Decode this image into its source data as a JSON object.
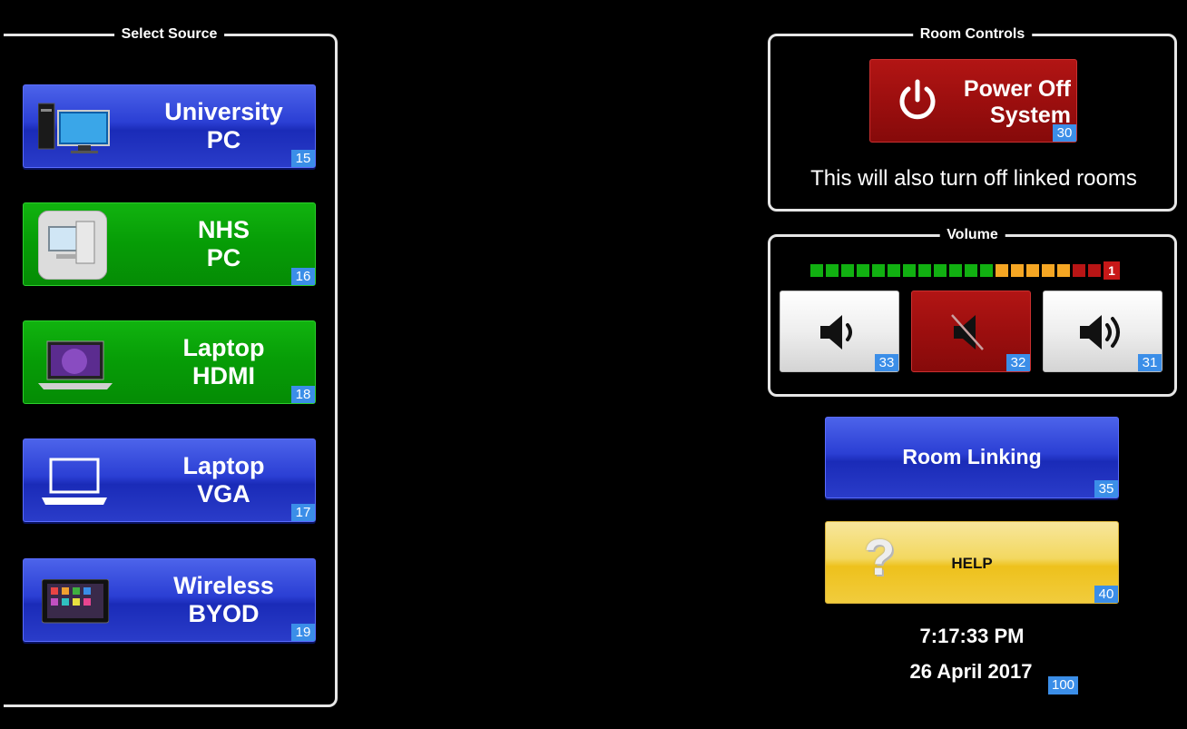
{
  "source_panel": {
    "title": "Select Source",
    "items": [
      {
        "line1": "University",
        "line2": "PC",
        "number": "15",
        "icon": "desktop-computer-icon"
      },
      {
        "line1": "NHS",
        "line2": "PC",
        "number": "16",
        "icon": "workstation-icon"
      },
      {
        "line1": "Laptop",
        "line2": "HDMI",
        "number": "18",
        "icon": "laptop-icon"
      },
      {
        "line1": "Laptop",
        "line2": "VGA",
        "number": "17",
        "icon": "laptop-outline-icon"
      },
      {
        "line1": "Wireless",
        "line2": "BYOD",
        "number": "19",
        "icon": "tablet-icon"
      }
    ]
  },
  "room_controls": {
    "title": "Room Controls",
    "power_button": {
      "line1": "Power Off",
      "line2": "System",
      "number": "30",
      "icon": "power-icon"
    },
    "note": "This will also turn off linked rooms"
  },
  "volume": {
    "title": "Volume",
    "level": "1",
    "segment_colors": {
      "green": "#11b011",
      "orange": "#f5a623",
      "red": "#b81515"
    },
    "volume_down": {
      "number": "33",
      "icon": "volume-down-icon"
    },
    "mute": {
      "number": "32",
      "icon": "mute-icon"
    },
    "volume_up": {
      "number": "31",
      "icon": "volume-up-icon"
    }
  },
  "room_linking": {
    "label": "Room Linking",
    "number": "35"
  },
  "help": {
    "label": "HELP",
    "number": "40",
    "icon": "question-mark-icon"
  },
  "clock": {
    "time": "7:17:33 PM",
    "date": "26 April 2017",
    "number": "100"
  }
}
